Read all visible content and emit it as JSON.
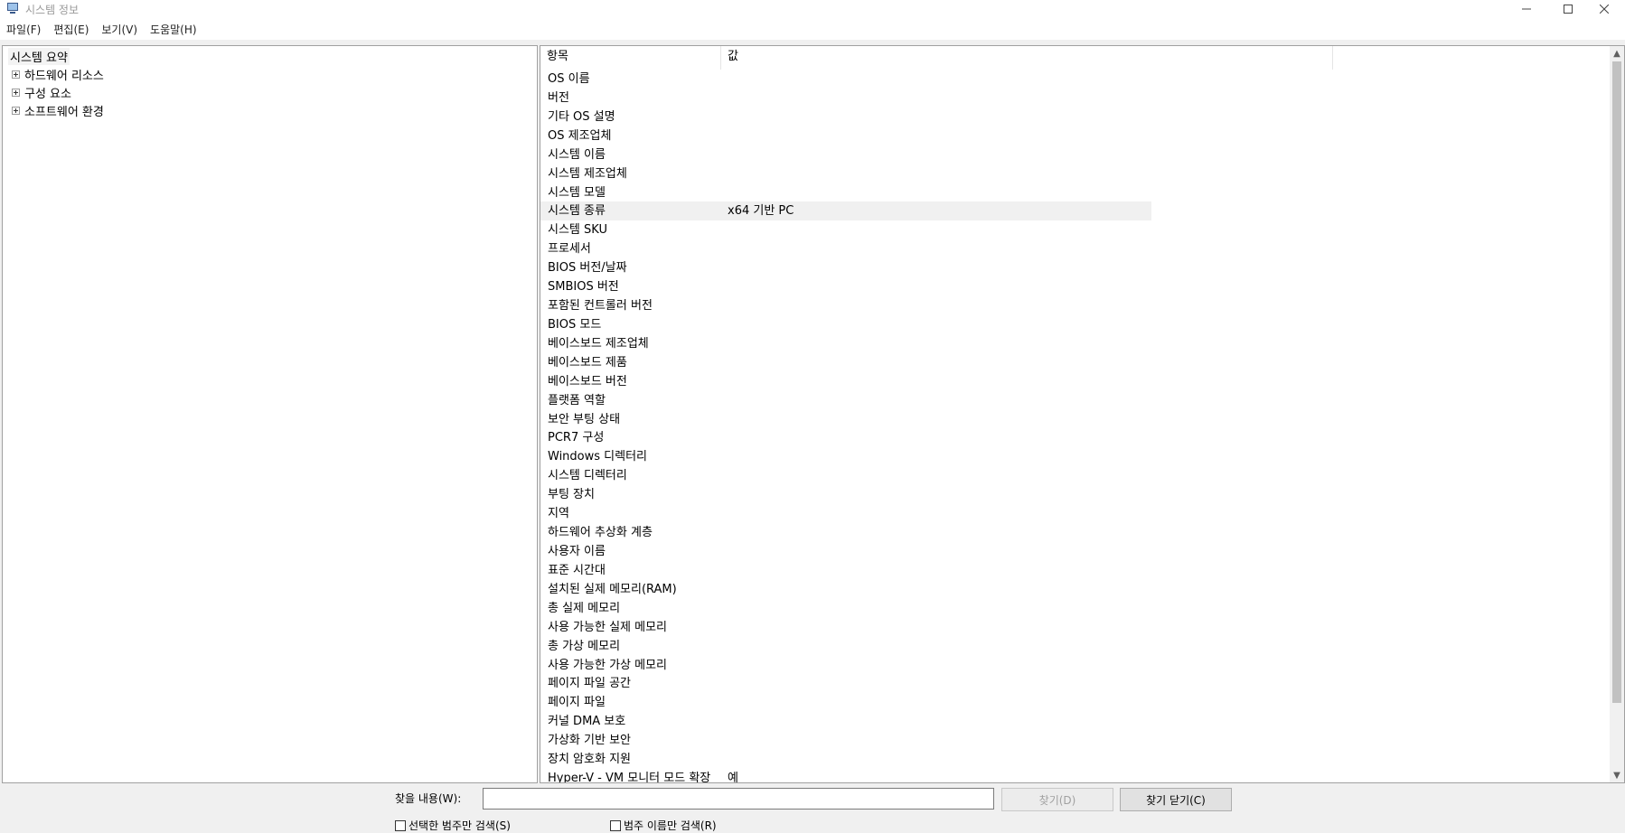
{
  "window": {
    "title": "시스템 정보",
    "icon": "system-info-icon"
  },
  "menu": [
    "파일(F)",
    "편집(E)",
    "보기(V)",
    "도움말(H)"
  ],
  "tree": {
    "root": "시스템 요약",
    "children": [
      "하드웨어 리소스",
      "구성 요소",
      "소프트웨어 환경"
    ]
  },
  "table": {
    "headers": {
      "item": "항목",
      "value": "값"
    },
    "selected_index": 7,
    "rows": [
      {
        "item": "OS 이름",
        "value": ""
      },
      {
        "item": "버전",
        "value": ""
      },
      {
        "item": "기타 OS 설명",
        "value": ""
      },
      {
        "item": "OS 제조업체",
        "value": ""
      },
      {
        "item": "시스템 이름",
        "value": ""
      },
      {
        "item": "시스템 제조업체",
        "value": ""
      },
      {
        "item": "시스템 모델",
        "value": ""
      },
      {
        "item": "시스템 종류",
        "value": "x64 기반 PC"
      },
      {
        "item": "시스템 SKU",
        "value": ""
      },
      {
        "item": "프로세서",
        "value": ""
      },
      {
        "item": "BIOS 버전/날짜",
        "value": ""
      },
      {
        "item": "SMBIOS 버전",
        "value": ""
      },
      {
        "item": "포함된 컨트롤러 버전",
        "value": ""
      },
      {
        "item": "BIOS 모드",
        "value": ""
      },
      {
        "item": "베이스보드 제조업체",
        "value": ""
      },
      {
        "item": "베이스보드 제품",
        "value": ""
      },
      {
        "item": "베이스보드 버전",
        "value": ""
      },
      {
        "item": "플랫폼 역할",
        "value": ""
      },
      {
        "item": "보안 부팅 상태",
        "value": ""
      },
      {
        "item": "PCR7 구성",
        "value": ""
      },
      {
        "item": "Windows 디렉터리",
        "value": ""
      },
      {
        "item": "시스템 디렉터리",
        "value": ""
      },
      {
        "item": "부팅 장치",
        "value": ""
      },
      {
        "item": "지역",
        "value": ""
      },
      {
        "item": "하드웨어 추상화 계층",
        "value": ""
      },
      {
        "item": "사용자 이름",
        "value": ""
      },
      {
        "item": "표준 시간대",
        "value": ""
      },
      {
        "item": "설치된 실제 메모리(RAM)",
        "value": ""
      },
      {
        "item": "총 실제 메모리",
        "value": ""
      },
      {
        "item": "사용 가능한 실제 메모리",
        "value": ""
      },
      {
        "item": "총 가상 메모리",
        "value": ""
      },
      {
        "item": "사용 가능한 가상 메모리",
        "value": ""
      },
      {
        "item": "페이지 파일 공간",
        "value": ""
      },
      {
        "item": "페이지 파일",
        "value": ""
      },
      {
        "item": "커널 DMA 보호",
        "value": ""
      },
      {
        "item": "가상화 기반 보안",
        "value": ""
      },
      {
        "item": "장치 암호화 지원",
        "value": ""
      },
      {
        "item": "Hyper-V - VM 모니터 모드 확장",
        "value": "예"
      }
    ]
  },
  "find": {
    "label": "찾을 내용(W):",
    "value": "",
    "find_button": "찾기(D)",
    "close_button": "찾기 닫기(C)",
    "check_selected_category": "선택한 범주만 검색(S)",
    "check_category_names": "범주 이름만 검색(R)"
  }
}
